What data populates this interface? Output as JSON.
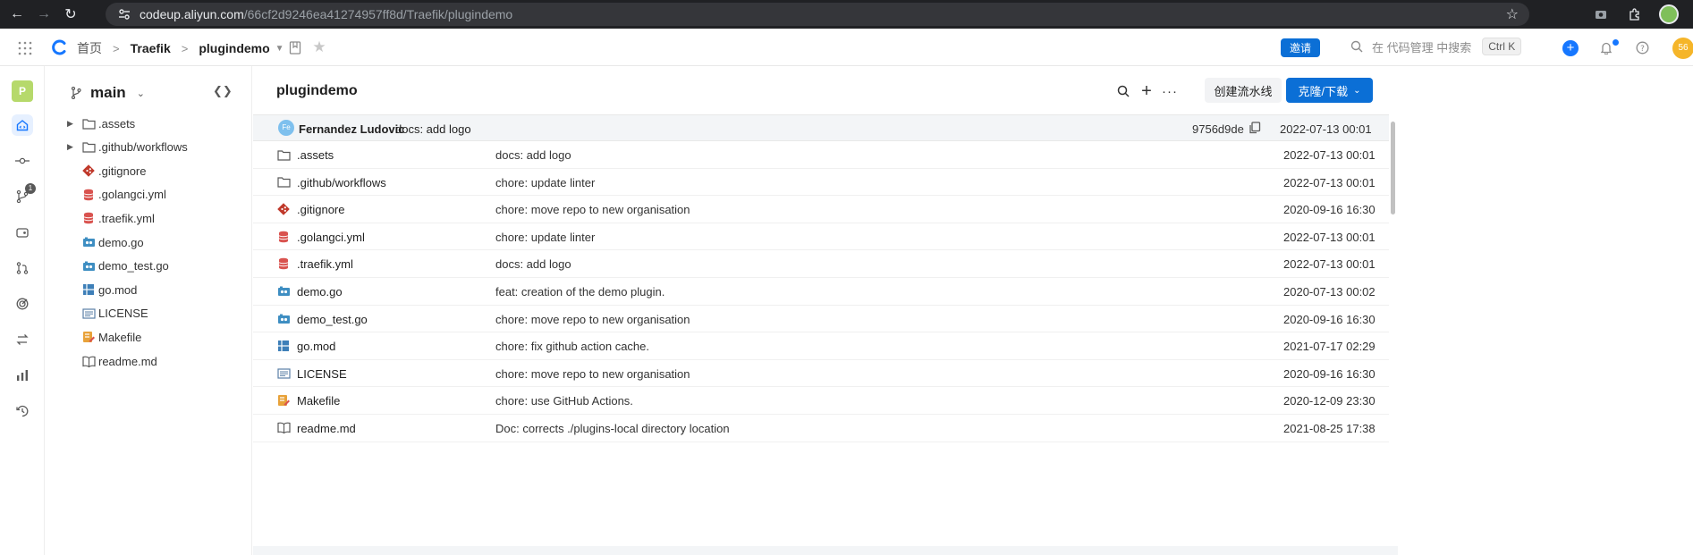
{
  "browser": {
    "url_host": "codeup.aliyun.com",
    "url_path": "/66cf2d9246ea41274957ff8d/Traefik/plugindemo"
  },
  "header": {
    "breadcrumb": [
      "首页",
      "Traefik",
      "plugindemo"
    ],
    "invite_label": "邀请",
    "search_placeholder": "在 代码管理 中搜索",
    "search_shortcut": "Ctrl K",
    "user_avatar_text": "56"
  },
  "rail": {
    "project_initial": "P",
    "merge_badge": "1"
  },
  "tree": {
    "branch": "main",
    "items": [
      {
        "name": ".assets",
        "type": "folder",
        "expandable": true
      },
      {
        "name": ".github/workflows",
        "type": "folder",
        "expandable": true
      },
      {
        "name": ".gitignore",
        "type": "git",
        "expandable": false
      },
      {
        "name": ".golangci.yml",
        "type": "yml",
        "expandable": false
      },
      {
        "name": ".traefik.yml",
        "type": "yml",
        "expandable": false
      },
      {
        "name": "demo.go",
        "type": "go",
        "expandable": false
      },
      {
        "name": "demo_test.go",
        "type": "go",
        "expandable": false
      },
      {
        "name": "go.mod",
        "type": "mod",
        "expandable": false
      },
      {
        "name": "LICENSE",
        "type": "license",
        "expandable": false
      },
      {
        "name": "Makefile",
        "type": "makefile",
        "expandable": false
      },
      {
        "name": "readme.md",
        "type": "md",
        "expandable": false
      }
    ]
  },
  "main": {
    "repo_title": "plugindemo",
    "pipeline_label": "创建流水线",
    "clone_label": "克隆/下载",
    "latest_commit": {
      "avatar_text": "Fe",
      "author": "Fernandez Ludovic",
      "message": "docs: add logo",
      "sha": "9756d9de",
      "date": "2022-07-13 00:01"
    },
    "files": [
      {
        "name": ".assets",
        "type": "folder",
        "message": "docs: add logo",
        "date": "2022-07-13 00:01"
      },
      {
        "name": ".github/workflows",
        "type": "folder",
        "message": "chore: update linter",
        "date": "2022-07-13 00:01"
      },
      {
        "name": ".gitignore",
        "type": "git",
        "message": "chore: move repo to new organisation",
        "date": "2020-09-16 16:30"
      },
      {
        "name": ".golangci.yml",
        "type": "yml",
        "message": "chore: update linter",
        "date": "2022-07-13 00:01"
      },
      {
        "name": ".traefik.yml",
        "type": "yml",
        "message": "docs: add logo",
        "date": "2022-07-13 00:01"
      },
      {
        "name": "demo.go",
        "type": "go",
        "message": "feat: creation of the demo plugin.",
        "date": "2020-07-13 00:02"
      },
      {
        "name": "demo_test.go",
        "type": "go",
        "message": "chore: move repo to new organisation",
        "date": "2020-09-16 16:30"
      },
      {
        "name": "go.mod",
        "type": "mod",
        "message": "chore: fix github action cache.",
        "date": "2021-07-17 02:29"
      },
      {
        "name": "LICENSE",
        "type": "license",
        "message": "chore: move repo to new organisation",
        "date": "2020-09-16 16:30"
      },
      {
        "name": "Makefile",
        "type": "makefile",
        "message": "chore: use GitHub Actions.",
        "date": "2020-12-09 23:30"
      },
      {
        "name": "readme.md",
        "type": "md",
        "message": "Doc: corrects ./plugins-local directory location",
        "date": "2021-08-25 17:38"
      }
    ]
  },
  "colors": {
    "accent": "#0b6fd6",
    "git_icon": "#c0392b",
    "yml_icon": "#d9534f",
    "go_icon": "#3e8ec2",
    "mod_icon": "#3e7fb8",
    "makefile_icon": "#e8a23a"
  }
}
